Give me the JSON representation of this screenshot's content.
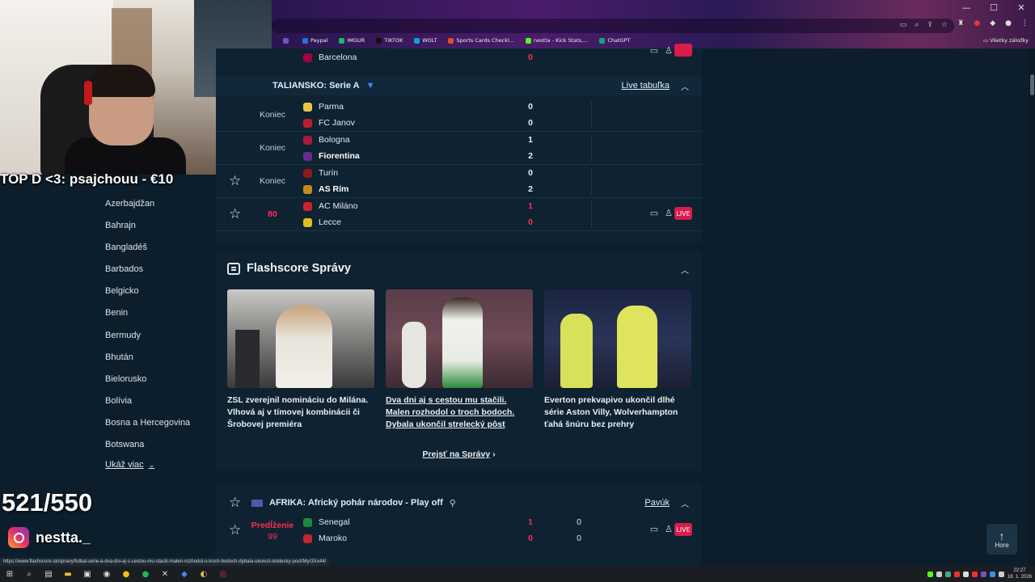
{
  "browser": {
    "window_controls": [
      "—",
      "☐",
      "✕"
    ],
    "bookmarks": [
      {
        "label": "",
        "color": "#7a4fc2"
      },
      {
        "label": "Paypal",
        "color": "#2b6ed9"
      },
      {
        "label": "IMGUR",
        "color": "#1bb76e"
      },
      {
        "label": "TIKTOK",
        "color": "#111111"
      },
      {
        "label": "WOLT",
        "color": "#00a7e1"
      },
      {
        "label": "Sports Cards Checkl...",
        "color": "#e34b2a"
      },
      {
        "label": "nestta - Kick Stats,...",
        "color": "#53fc18"
      },
      {
        "label": "ChatGPT",
        "color": "#10a37f"
      }
    ],
    "all_bookmarks": "Všetky záložky",
    "status_url": "https://www.flashscore.sk/spravy/futbal-serie-a-dva-dni-aj-s-cestou-mu-stacili-malen-rozhodol-o-troch-bodoch-dybala-ukoncil-strelecky-post/Myr3Xx44/"
  },
  "stream": {
    "donation": "TOP D <3: psajchouu - €10",
    "counter": "521/550",
    "instagram_handle": "nestta._"
  },
  "sidebar": {
    "countries": [
      "Azerbajdžan",
      "Bahrajn",
      "Bangladéš",
      "Barbados",
      "Belgicko",
      "Benin",
      "Bermudy",
      "Bhután",
      "Bielorusko",
      "Bolívia",
      "Bosna a Hercegovina",
      "Botswana"
    ],
    "show_more": "Ukáž viac"
  },
  "serie_a": {
    "prev_match": {
      "team": "Barcelona",
      "score": "0"
    },
    "league": "TALIANSKO: Serie A",
    "live_table": "Live tabuľka",
    "matches": [
      {
        "status": "Koniec",
        "home": "Parma",
        "away": "FC Janov",
        "home_score": "0",
        "away_score": "0",
        "home_win": false,
        "away_win": false,
        "live": false,
        "home_color": "#e8c64a",
        "away_color": "#b5202e"
      },
      {
        "status": "Koniec",
        "home": "Bologna",
        "away": "Fiorentina",
        "home_score": "1",
        "away_score": "2",
        "home_win": false,
        "away_win": true,
        "live": false,
        "home_color": "#a51d3c",
        "away_color": "#6a2c91"
      },
      {
        "status": "Koniec",
        "home": "Turín",
        "away": "AS Rím",
        "home_score": "0",
        "away_score": "2",
        "home_win": false,
        "away_win": true,
        "live": false,
        "home_color": "#8b1a1a",
        "away_color": "#c48a1d"
      },
      {
        "status": "80",
        "home": "AC Miláno",
        "away": "Lecce",
        "home_score": "1",
        "away_score": "0",
        "home_win": false,
        "away_win": false,
        "live": true,
        "home_color": "#d0202e",
        "away_color": "#e0c020"
      }
    ],
    "live_badge": "LIVE"
  },
  "news": {
    "title": "Flashscore Správy",
    "articles": [
      {
        "text": "ZSL zverejnil nomináciu do Milána. Vlhová aj v tímovej kombinácii či Šrobovej premiéra",
        "underlined": false
      },
      {
        "text": "Dva dni aj s cestou mu stačili. Malen rozhodol o troch bodoch. Dybala ukončil strelecký pôst",
        "underlined": true
      },
      {
        "text": "Everton prekvapivo ukončil dlhé série Aston Villy, Wolverhampton ťahá šnúru bez prehry",
        "underlined": false
      }
    ],
    "more": "Prejsť na Správy"
  },
  "afcon": {
    "league": "AFRIKA: Africký pohár národov - Play off",
    "bracket": "Pavúk",
    "match": {
      "status": "Predĺženie",
      "minute": "99",
      "home": "Senegal",
      "away": "Maroko",
      "home_score": "1",
      "away_score": "0",
      "home_ht": "0",
      "away_ht": "0",
      "home_color": "#1b8a3c",
      "away_color": "#c1272d"
    }
  },
  "hore": "Hore",
  "taskbar": {
    "time": "22:27",
    "date": "18. 1. 2026"
  }
}
